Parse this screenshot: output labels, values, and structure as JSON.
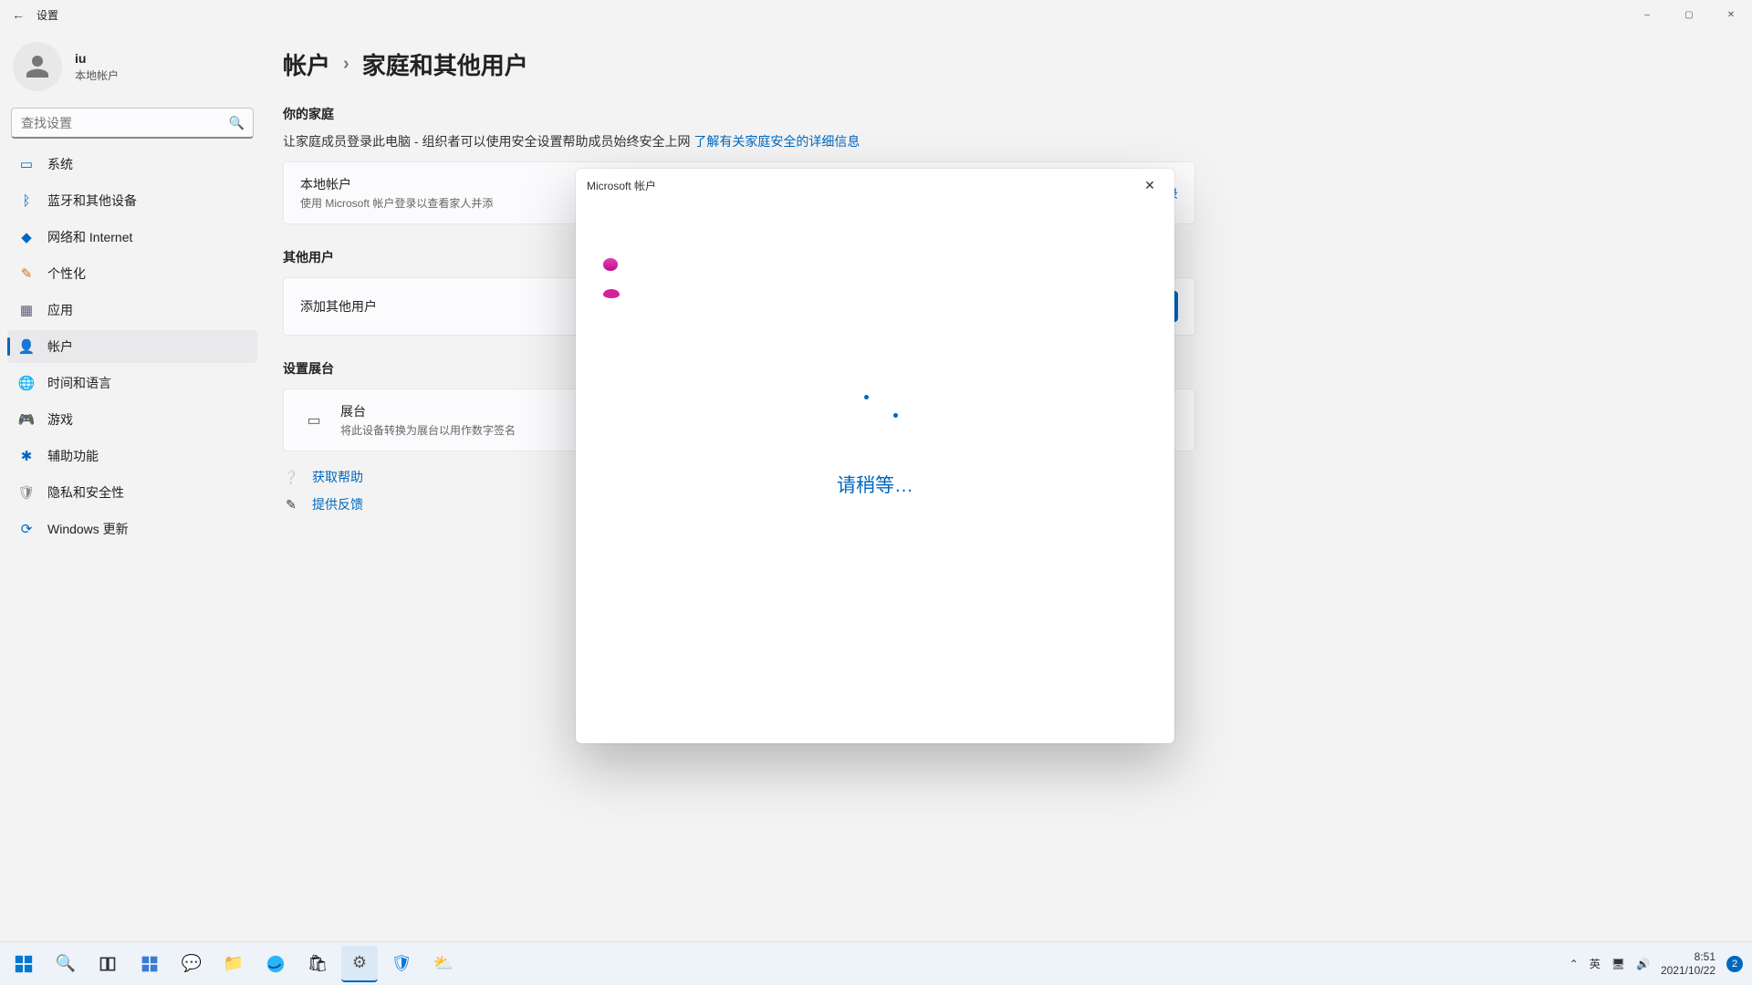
{
  "window": {
    "title": "设置",
    "minimize": "–",
    "maximize": "▢",
    "close": "✕"
  },
  "profile": {
    "name": "iu",
    "sub": "本地帐户"
  },
  "search": {
    "placeholder": "查找设置"
  },
  "sidebar": {
    "items": [
      {
        "label": "系统",
        "icon": "💻",
        "color": "#0067c0"
      },
      {
        "label": "蓝牙和其他设备",
        "icon": "ᛒ",
        "color": "#0067c0"
      },
      {
        "label": "网络和 Internet",
        "icon": "📶",
        "color": "#0067c0"
      },
      {
        "label": "个性化",
        "icon": "🖌",
        "color": "#d56f1c"
      },
      {
        "label": "应用",
        "icon": "▦",
        "color": "#5a5a7a"
      },
      {
        "label": "帐户",
        "icon": "👤",
        "color": "#3a945d"
      },
      {
        "label": "时间和语言",
        "icon": "🌐",
        "color": "#3a945d"
      },
      {
        "label": "游戏",
        "icon": "🎮",
        "color": "#888"
      },
      {
        "label": "辅助功能",
        "icon": "✱",
        "color": "#0067c0"
      },
      {
        "label": "隐私和安全性",
        "icon": "🛡",
        "color": "#888"
      },
      {
        "label": "Windows 更新",
        "icon": "🔄",
        "color": "#0067c0"
      }
    ]
  },
  "breadcrumb": {
    "parent": "帐户",
    "sep": "›",
    "current": "家庭和其他用户"
  },
  "sections": {
    "family": {
      "heading": "你的家庭",
      "desc": "让家庭成员登录此电脑 - 组织者可以使用安全设置帮助成员始终安全上网",
      "link": "了解有关家庭安全的详细信息",
      "card_title": "本地帐户",
      "card_sub": "使用 Microsoft 帐户登录以查看家人并添",
      "card_action": "录"
    },
    "others": {
      "heading": "其他用户",
      "card_title": "添加其他用户"
    },
    "kiosk": {
      "heading": "设置展台",
      "card_title": "展台",
      "card_sub": "将此设备转换为展台以用作数字签名"
    }
  },
  "help": {
    "get_help": "获取帮助",
    "feedback": "提供反馈"
  },
  "modal": {
    "title": "Microsoft 帐户",
    "loading": "请稍等…"
  },
  "taskbar": {
    "ime": "英",
    "time": "8:51",
    "date": "2021/10/22",
    "notif_count": "2"
  }
}
